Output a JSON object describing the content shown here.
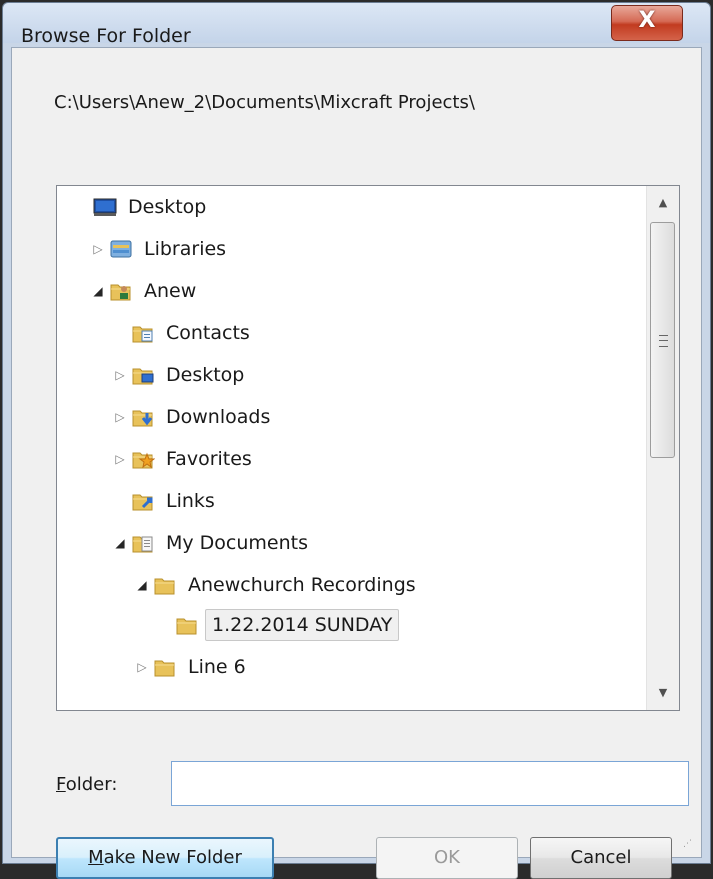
{
  "window": {
    "title": "Browse For Folder",
    "close_glyph": "X"
  },
  "path": "C:\\Users\\Anew_2\\Documents\\Mixcraft Projects\\",
  "tree": {
    "items": [
      {
        "label": "Desktop",
        "icon": "desktop-icon",
        "expander": ""
      },
      {
        "label": "Libraries",
        "icon": "libraries-icon",
        "expander": "collapsed"
      },
      {
        "label": "Anew",
        "icon": "user-folder-icon",
        "expander": "expanded"
      },
      {
        "label": "Contacts",
        "icon": "contacts-folder-icon",
        "expander": ""
      },
      {
        "label": "Desktop",
        "icon": "desktop-folder-icon",
        "expander": "collapsed"
      },
      {
        "label": "Downloads",
        "icon": "downloads-folder-icon",
        "expander": "collapsed"
      },
      {
        "label": "Favorites",
        "icon": "favorites-folder-icon",
        "expander": "collapsed"
      },
      {
        "label": "Links",
        "icon": "links-folder-icon",
        "expander": ""
      },
      {
        "label": "My Documents",
        "icon": "documents-folder-icon",
        "expander": "expanded"
      },
      {
        "label": "Anewchurch Recordings",
        "icon": "folder-icon",
        "expander": "expanded"
      },
      {
        "label": "1.22.2014 SUNDAY",
        "icon": "folder-icon",
        "expander": "",
        "selected": true
      },
      {
        "label": "Line 6",
        "icon": "folder-icon",
        "expander": "collapsed"
      }
    ]
  },
  "folder_field": {
    "label_prefix": "",
    "label_underlined": "F",
    "label_rest": "older:",
    "value": ""
  },
  "buttons": {
    "make_new_folder_underlined": "M",
    "make_new_folder_rest": "ake New Folder",
    "ok": "OK",
    "cancel": "Cancel"
  },
  "colors": {
    "accent": "#3c7fb1",
    "close": "#c23b20",
    "folder": "#e8c25a"
  }
}
